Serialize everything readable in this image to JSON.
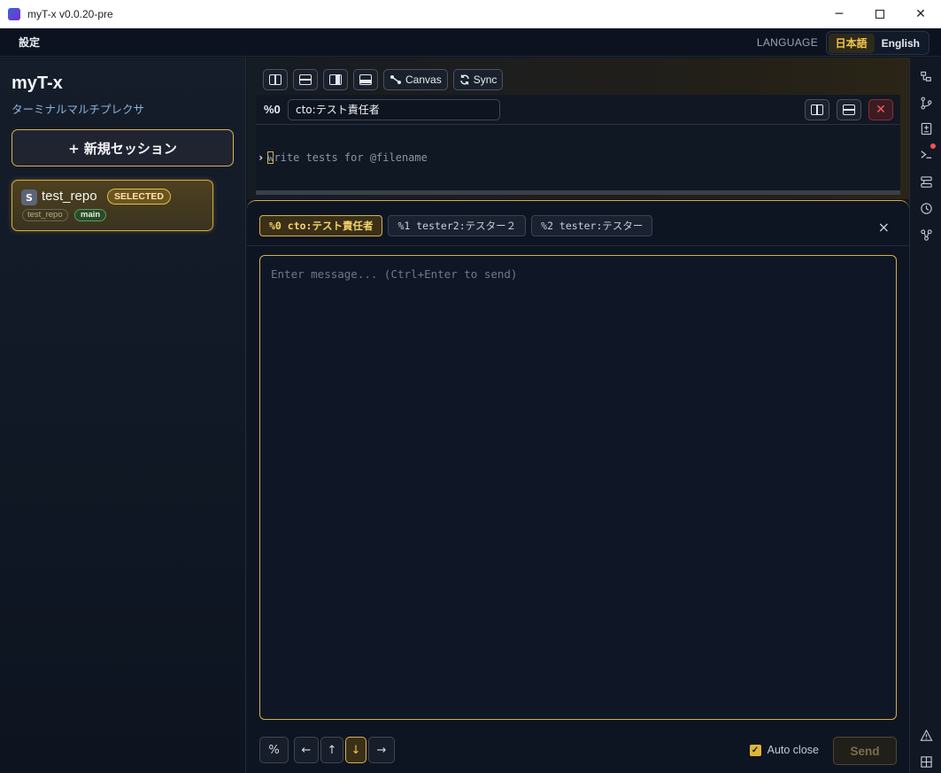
{
  "window": {
    "title": "myT-x v0.0.20-pre",
    "controls": {
      "minimize": "─",
      "close": "✕"
    }
  },
  "menubar": {
    "settings": "設定",
    "language_label": "LANGUAGE",
    "languages": [
      {
        "label": "日本語",
        "active": true
      },
      {
        "label": "English",
        "active": false
      }
    ]
  },
  "sidebar": {
    "app_name": "myT-x",
    "app_subtitle": "ターミナルマルチプレクサ",
    "new_session_label": "+ 新規セッション",
    "sessions": [
      {
        "badge": "S",
        "name": "test_repo",
        "status": "SELECTED",
        "repo": "test_repo",
        "branch": "main"
      }
    ]
  },
  "toolbar": {
    "canvas_label": "Canvas",
    "sync_label": "Sync"
  },
  "pane": {
    "id": "%0",
    "title_value": "cto:テスト責任者",
    "prompt_marker": "›",
    "prompt_placeholder": "write tests for @filename",
    "close_glyph": "✕"
  },
  "message_panel": {
    "tabs": [
      {
        "label": "%0 cto:テスト責任者",
        "active": true
      },
      {
        "label": "%1 tester2:テスター２",
        "active": false
      },
      {
        "label": "%2 tester:テスター",
        "active": false
      }
    ],
    "close_glyph": "×",
    "placeholder": "Enter message... (Ctrl+Enter to send)",
    "keys": {
      "percent": "%",
      "left": "←",
      "up": "↑",
      "down": "↓",
      "right": "→"
    },
    "active_key": "down",
    "auto_close_label": "Auto close",
    "auto_close_checked": true,
    "send_label": "Send"
  },
  "colors": {
    "accent": "#d9b24a",
    "background": "#0f1622",
    "danger": "#ff5c66",
    "branch_green": "#5a9b5b"
  },
  "activity_bar": {
    "icons": [
      "file-tree-icon",
      "git-branch-icon",
      "diff-icon",
      "terminal-icon",
      "layout-icon",
      "history-icon",
      "team-icon",
      "warning-icon",
      "grid-icon"
    ]
  }
}
